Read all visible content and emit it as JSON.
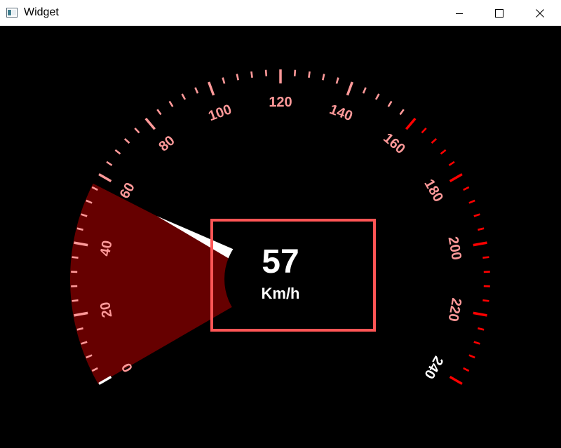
{
  "window": {
    "title": "Widget",
    "icon": "app-window-icon",
    "controls": [
      "minimize-icon",
      "maximize-icon",
      "close-icon"
    ]
  },
  "gauge": {
    "value": 57,
    "unit": "Km/h",
    "min": 0,
    "max": 240,
    "major_step": 20,
    "minor_step": 4,
    "tick_labels": [
      "0",
      "20",
      "40",
      "60",
      "80",
      "100",
      "120",
      "140",
      "160",
      "180",
      "200",
      "220",
      "240"
    ],
    "redline_from": 160,
    "colors": {
      "face": "#660000",
      "normal_tick": "#ff9999",
      "redline_tick": "#ff0000",
      "end_tick": "#ffffff",
      "needle": "#ffffff",
      "readout_box": "#ff5555",
      "readout_text": "#ffffff"
    }
  }
}
